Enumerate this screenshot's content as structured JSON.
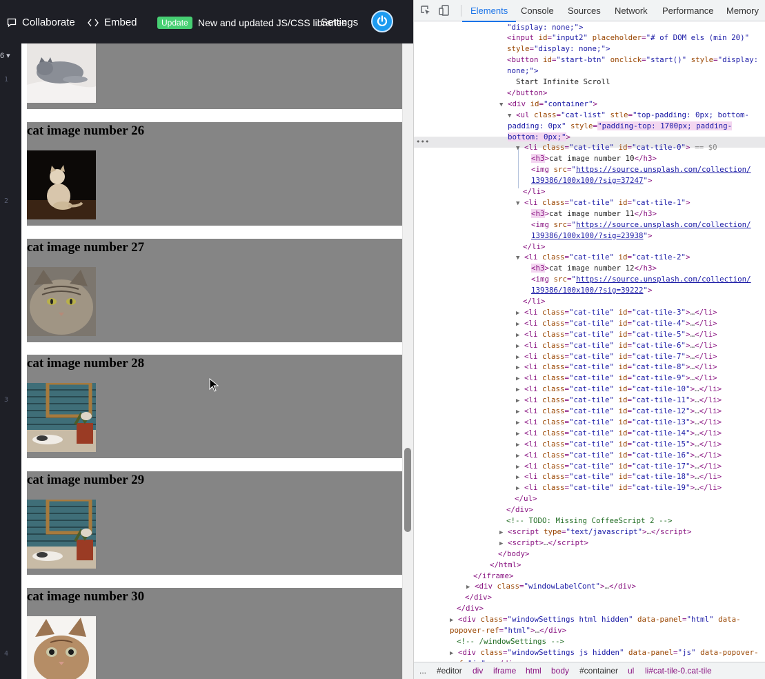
{
  "header": {
    "collaborate_label": "Collaborate",
    "embed_label": "Embed",
    "update_badge": "Update",
    "news_text": "New and updated JS/CSS libraries",
    "settings_label": "Settings"
  },
  "gutter": {
    "top_label": "6 ▾",
    "numbers": [
      "1",
      "2",
      "3",
      "4"
    ]
  },
  "preview": {
    "tiles": [
      {
        "title": "cat image number 26"
      },
      {
        "title": "cat image number 27"
      },
      {
        "title": "cat image number 28"
      },
      {
        "title": "cat image number 29"
      },
      {
        "title": "cat image number 30"
      }
    ]
  },
  "devtools": {
    "tabs": [
      "Elements",
      "Console",
      "Sources",
      "Network",
      "Performance",
      "Memory"
    ],
    "active_tab": "Elements",
    "breadcrumbs": [
      "...",
      "#editor",
      "div",
      "iframe",
      "html",
      "body",
      "#container",
      "ul",
      "li#cat-tile-0.cat-tile"
    ],
    "dom": {
      "line0": "\"display: none;\">",
      "input2_id": "\"input2\"",
      "input2_placeholder": "\"# of DOM els (min 20)\"",
      "input2_style": "\"display: none;\">",
      "btn_id": "\"start-btn\"",
      "btn_onclick": "\"start()\"",
      "btn_style_a": "\"display:",
      "btn_style_b": "none;\">",
      "btn_text": "Start Infinite Scroll",
      "container_id": "\"container\"",
      "ul_class": "\"cat-list\"",
      "ul_stle": "\"top-padding: 0px; bottom-",
      "ul_stle_b": "padding: 0px\"",
      "ul_style": "\"padding-top: 1700px; padding-",
      "ul_style_b": "bottom: 0px;\"",
      "selected_marker": "== $0",
      "li_class": "\"cat-tile\"",
      "open_items": [
        {
          "id": "\"cat-tile-0\"",
          "h3": "cat image number 10",
          "src_a": "https://source.unsplash.com/collection/",
          "src_b": "139386/100x100/?sig=37247"
        },
        {
          "id": "\"cat-tile-1\"",
          "h3": "cat image number 11",
          "src_a": "https://source.unsplash.com/collection/",
          "src_b": "139386/100x100/?sig=23938"
        },
        {
          "id": "\"cat-tile-2\"",
          "h3": "cat image number 12",
          "src_a": "https://source.unsplash.com/collection/",
          "src_b": "139386/100x100/?sig=39222"
        }
      ],
      "collapsed_ids": [
        "\"cat-tile-3\"",
        "\"cat-tile-4\"",
        "\"cat-tile-5\"",
        "\"cat-tile-6\"",
        "\"cat-tile-7\"",
        "\"cat-tile-8\"",
        "\"cat-tile-9\"",
        "\"cat-tile-10\"",
        "\"cat-tile-11\"",
        "\"cat-tile-12\"",
        "\"cat-tile-13\"",
        "\"cat-tile-14\"",
        "\"cat-tile-15\"",
        "\"cat-tile-16\"",
        "\"cat-tile-17\"",
        "\"cat-tile-18\"",
        "\"cat-tile-19\""
      ],
      "todo_comment": "<!-- TODO: Missing CoffeeScript 2 -->",
      "script_type": "\"text/javascript\"",
      "label_cont_class": "\"windowLabelCont\"",
      "ws_html_class": "\"windowSettings html hidden\"",
      "ws_html_panel": "\"html\"",
      "ws_html_ref": "\"html\"",
      "ws_comment": "<!-- /windowSettings -->",
      "ws_js_class": "\"windowSettings js hidden\"",
      "ws_js_panel": "\"js\"",
      "ws_js_ref": "\"js\""
    }
  },
  "colors": {
    "header_bg": "#1e1f26",
    "update_green": "#47cf73",
    "tile_gray": "#858585",
    "devtools_accent": "#1a73e8",
    "tag_purple": "#881280",
    "attr_brown": "#994500",
    "value_blue": "#1a1aa6",
    "comment_green": "#236e25"
  }
}
